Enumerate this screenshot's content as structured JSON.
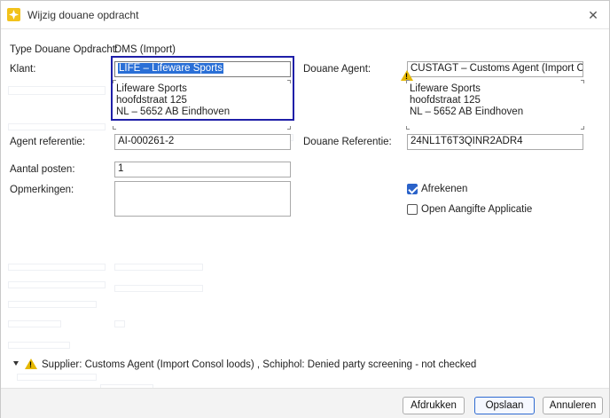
{
  "window": {
    "title": "Wijzig douane opdracht",
    "close_glyph": "✕"
  },
  "form": {
    "type_label": "Type Douane Opdracht:",
    "type_value": "DMS (Import)",
    "klant_label": "Klant:",
    "klant_value": "LIFE – Lifeware Sports",
    "klant_address": [
      "Lifeware Sports",
      "hoofdstraat 125",
      "NL – 5652 AB Eindhoven"
    ],
    "agent_label": "Douane Agent:",
    "agent_value": "CUSTAGT – Customs Agent (Import Consol",
    "agent_address": [
      "Lifeware Sports",
      "hoofdstraat 125",
      "NL – 5652 AB Eindhoven"
    ],
    "agent_ref_label": "Agent referentie:",
    "agent_ref_value": "AI-000261-2",
    "douane_ref_label": "Douane Referentie:",
    "douane_ref_value": "24NL1T6T3QINR2ADR4",
    "posten_label": "Aantal posten:",
    "posten_value": "1",
    "opmerkingen_label": "Opmerkingen:",
    "opmerkingen_value": "",
    "afrekenen_label": "Afrekenen",
    "afrekenen_checked": true,
    "open_aangifte_label": "Open Aangifte Applicatie",
    "open_aangifte_checked": false
  },
  "warning": {
    "text": "Supplier: Customs Agent (Import Consol loods) , Schiphol: Denied party screening - not checked",
    "color": "#e6b800"
  },
  "buttons": {
    "print": "Afdrukken",
    "save": "Opslaan",
    "cancel": "Annuleren"
  },
  "colors": {
    "accent": "#2a62c9",
    "highlight_frame": "#1f1fa8"
  }
}
